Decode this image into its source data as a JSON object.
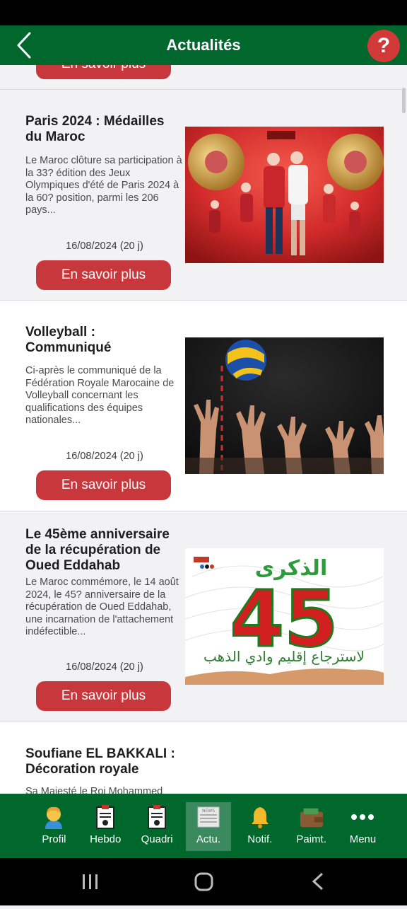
{
  "header": {
    "title": "Actualités"
  },
  "partial": {
    "label": "En savoir plus"
  },
  "articles": [
    {
      "title": "Paris 2024 : Médailles du Maroc",
      "excerpt": "Le Maroc clôture sa participation à la 33? édition des Jeux Olympiques d'été de Paris 2024 à la 60? position, parmi les 206 pays...",
      "date": "16/08/2024 (20 j)",
      "button": "En savoir plus"
    },
    {
      "title": "Volleyball : Communiqué",
      "excerpt": "Ci-après le communiqué de la Fédération Royale Marocaine de Volleyball concernant les qualifications des équipes nationales...",
      "date": "16/08/2024 (20 j)",
      "button": "En savoir plus"
    },
    {
      "title": "Le 45ème anniversaire de la récupération de Oued Eddahab",
      "excerpt": "Le Maroc commémore, le 14 août 2024, le 45? anniversaire de la récupération de Oued Eddahab, une incarnation de l'attachement indéfectible...",
      "date": "16/08/2024 (20 j)",
      "button": "En savoir plus",
      "image_number": "45",
      "image_caption": "الذكرى",
      "image_subcaption": "لاسترجاع إقليم وادي الذهب"
    },
    {
      "title": "Soufiane EL BAKKALI : Décoration royale",
      "excerpt": "Sa Majesté le Roi Mohammed"
    }
  ],
  "nav": [
    {
      "label": "Profil",
      "icon": "profile-icon"
    },
    {
      "label": "Hebdo",
      "icon": "weekly-report-icon"
    },
    {
      "label": "Quadri",
      "icon": "quarterly-report-icon"
    },
    {
      "label": "Actu.",
      "icon": "news-icon",
      "active": true,
      "icon_text": "NEWS"
    },
    {
      "label": "Notif.",
      "icon": "bell-icon"
    },
    {
      "label": "Paimt.",
      "icon": "wallet-icon"
    },
    {
      "label": "Menu",
      "icon": "more-icon"
    }
  ],
  "colors": {
    "primary": "#00672d",
    "accent": "#c8373b",
    "help": "#d23a3a"
  }
}
